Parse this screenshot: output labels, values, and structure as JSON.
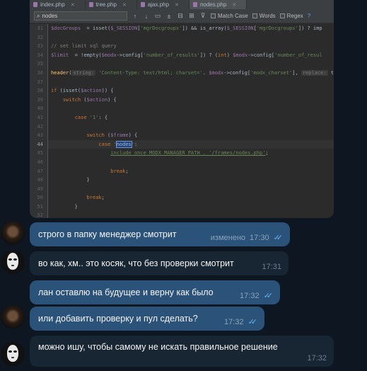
{
  "ide": {
    "tabs": [
      "index.php",
      "tree.php",
      "ajax.php",
      "nodes.php"
    ],
    "find": {
      "value": "nodes",
      "match_case": "Match Case",
      "words": "Words",
      "regex": "Regex",
      "help": "?"
    },
    "line_numbers": [
      "31",
      "32",
      "33",
      "34",
      "35",
      "36",
      "37",
      "38",
      "39",
      "40",
      "41",
      "42",
      "43",
      "44",
      "45",
      "46",
      "47",
      "48",
      "49",
      "50",
      "51",
      "52"
    ]
  },
  "chat": {
    "messages": [
      {
        "text": "строго в папку менеджер смотрит",
        "edited": "изменено",
        "time": "17:30"
      },
      {
        "text": "во как, хм.. это косяк, что без проверки смотрит",
        "time": "17:31"
      },
      {
        "text": "лан оставлю на будущее и верну как было",
        "time": "17:32"
      },
      {
        "text": "или добавить проверку и пул сделать?",
        "time": "17:32"
      },
      {
        "text": "можно ишу, чтобы самому не искать правильное решение",
        "time": "17:32"
      }
    ]
  }
}
